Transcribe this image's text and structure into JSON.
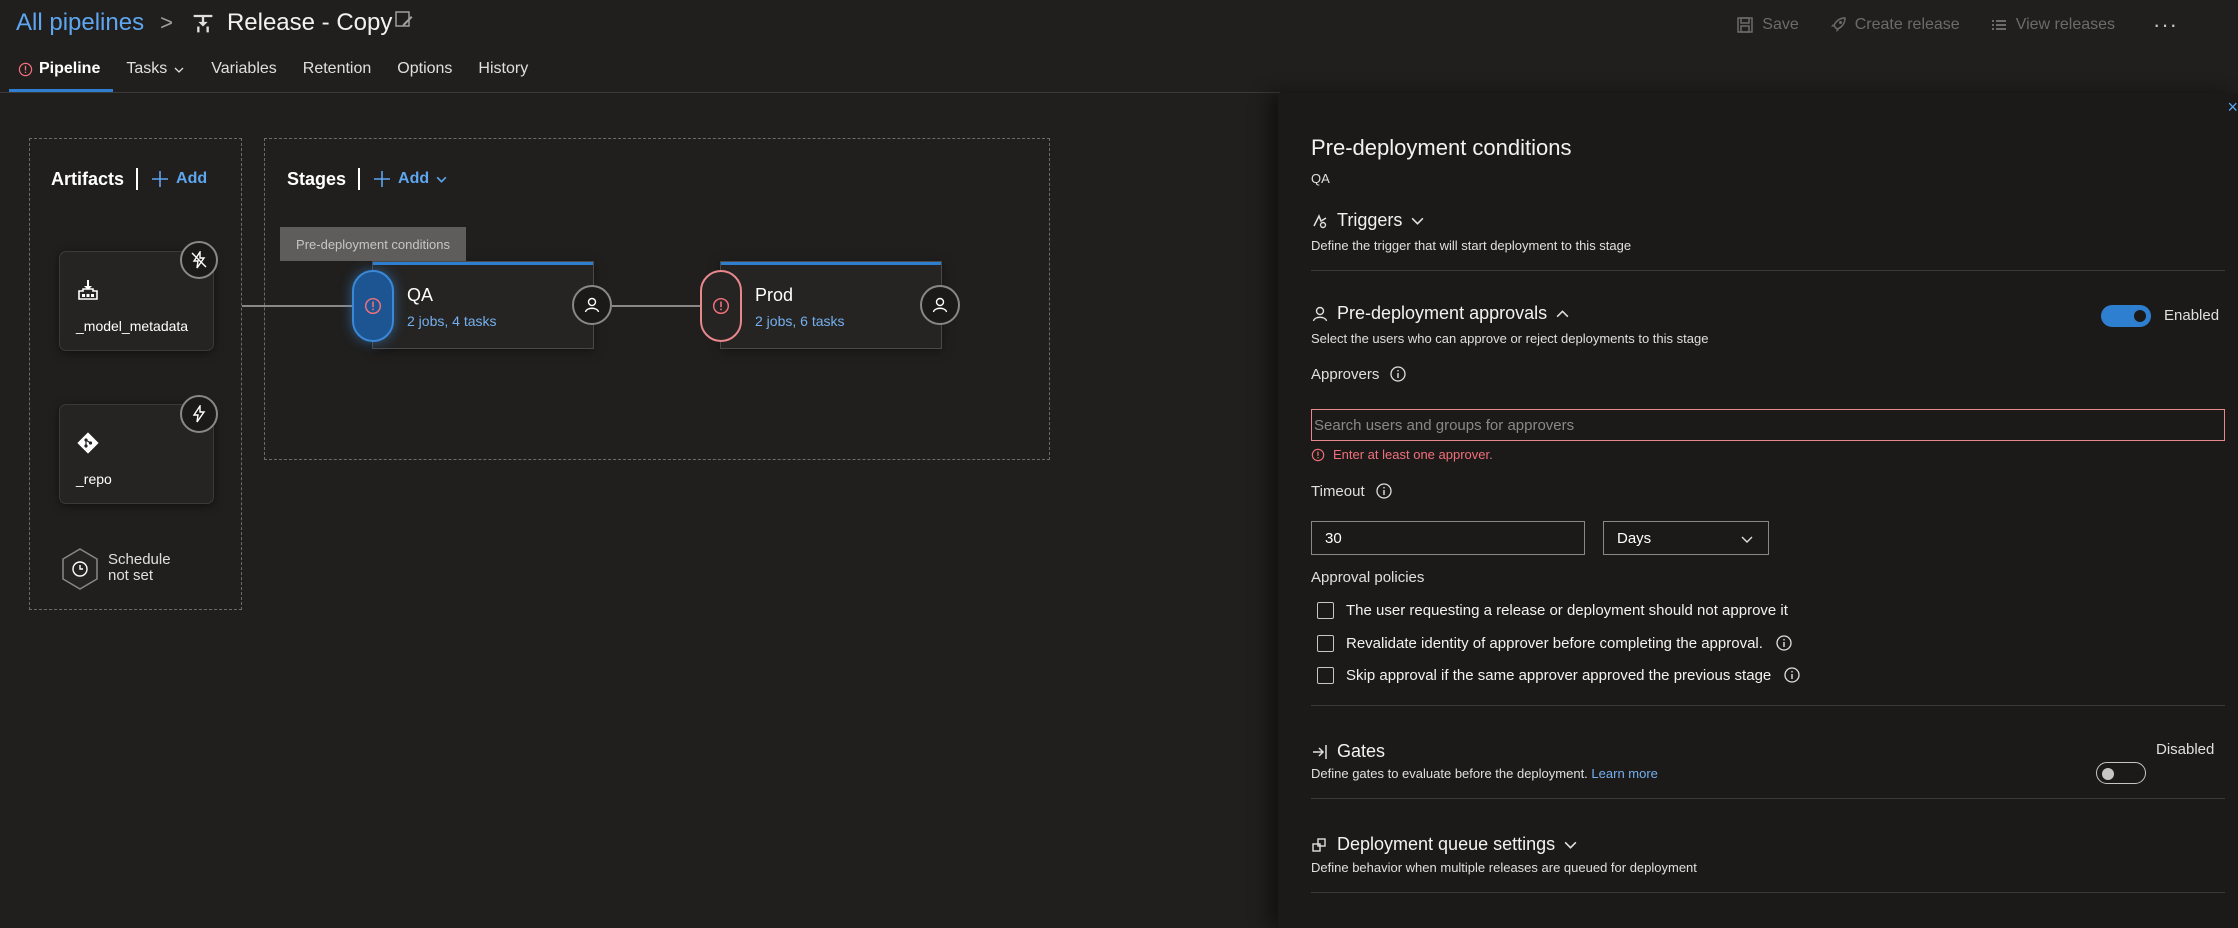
{
  "header": {
    "breadcrumb_link": "All pipelines",
    "breadcrumb_sep": ">",
    "release_title": "Release - Copy",
    "toolbar": {
      "save": "Save",
      "create_release": "Create release",
      "view_releases": "View releases",
      "more": "···"
    }
  },
  "tabs": [
    {
      "label": "Pipeline",
      "active": true,
      "has_error": true
    },
    {
      "label": "Tasks",
      "has_dropdown": true
    },
    {
      "label": "Variables"
    },
    {
      "label": "Retention"
    },
    {
      "label": "Options"
    },
    {
      "label": "History"
    }
  ],
  "artifacts": {
    "title": "Artifacts",
    "add_label": "Add",
    "items": [
      {
        "label": "_model_metadata",
        "icon": "build-icon"
      },
      {
        "label": "_repo",
        "icon": "git-icon"
      }
    ],
    "schedule": {
      "line1": "Schedule",
      "line2": "not set"
    }
  },
  "stages": {
    "title": "Stages",
    "add_label": "Add",
    "tooltip": "Pre-deployment conditions",
    "items": [
      {
        "name": "QA",
        "jobs": "2 jobs, 4 tasks",
        "selected": true
      },
      {
        "name": "Prod",
        "jobs": "2 jobs, 6 tasks",
        "selected": false
      }
    ]
  },
  "panel": {
    "title": "Pre-deployment conditions",
    "stage": "QA",
    "close": "×",
    "triggers": {
      "title": "Triggers",
      "desc": "Define the trigger that will start deployment to this stage"
    },
    "approvals": {
      "title": "Pre-deployment approvals",
      "desc": "Select the users who can approve or reject deployments to this stage",
      "toggle_label": "Enabled",
      "enabled": true,
      "approvers_label": "Approvers",
      "approvers_placeholder": "Search users and groups for approvers",
      "approvers_error": "Enter at least one approver.",
      "timeout_label": "Timeout",
      "timeout_value": "30",
      "timeout_unit": "Days",
      "policies_label": "Approval policies",
      "policies": [
        {
          "label": "The user requesting a release or deployment should not approve it",
          "checked": false,
          "info": false
        },
        {
          "label": "Revalidate identity of approver before completing the approval.",
          "checked": false,
          "info": true
        },
        {
          "label": "Skip approval if the same approver approved the previous stage",
          "checked": false,
          "info": true
        }
      ]
    },
    "gates": {
      "title": "Gates",
      "desc": "Define gates to evaluate before the deployment.",
      "learn_more": "Learn more",
      "toggle_label": "Disabled",
      "enabled": false
    },
    "queue": {
      "title": "Deployment queue settings",
      "desc": "Define behavior when multiple releases are queued for deployment"
    }
  },
  "colors": {
    "accent": "#2f7fd1",
    "link": "#5ea6f0",
    "error": "#f1707b",
    "background": "#201f1e",
    "panel": "#1b1a19"
  }
}
